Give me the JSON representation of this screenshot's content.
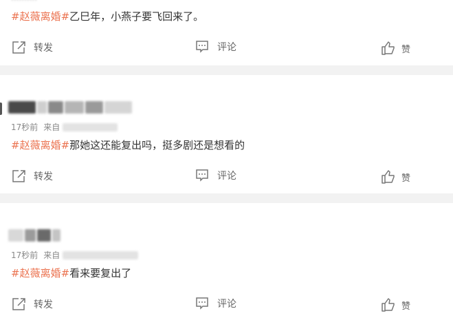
{
  "posts": [
    {
      "time": "",
      "source": "",
      "tag": "#赵薇离婚#",
      "text": "乙巳年，小燕子要飞回来了。",
      "actions": {
        "repost": "转发",
        "comment": "评论",
        "like": "赞"
      }
    },
    {
      "time": "17秒前",
      "source": "来自",
      "tag": "#赵薇离婚#",
      "text": "那她这还能复出吗，挺多剧还是想看的",
      "actions": {
        "repost": "转发",
        "comment": "评论",
        "like": "赞"
      }
    },
    {
      "time": "17秒前",
      "source": "来自",
      "tag": "#赵薇离婚#",
      "text": "看来要复出了",
      "actions": {
        "repost": "转发",
        "comment": "评论",
        "like": "赞"
      }
    }
  ],
  "colors": {
    "tag": "#eb7350",
    "separator": "#f2f2f2",
    "action_text": "#666666"
  },
  "icons": {
    "repost": "share-icon",
    "comment": "comment-icon",
    "like": "thumbs-up-icon"
  }
}
